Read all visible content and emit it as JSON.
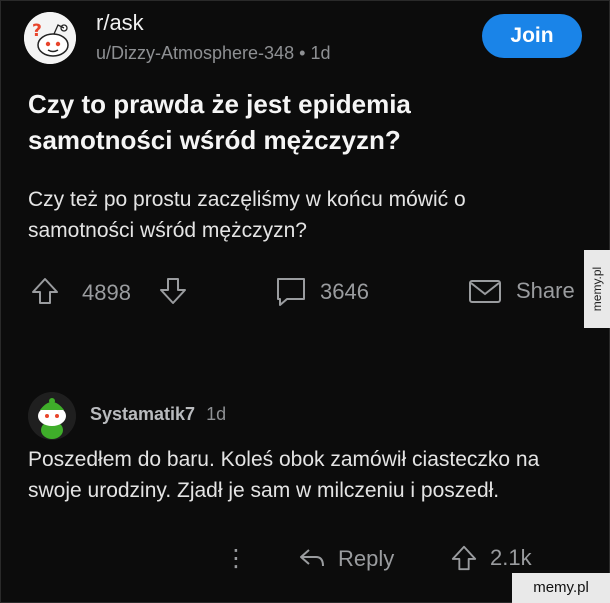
{
  "post": {
    "subreddit": "r/ask",
    "author": "u/Dizzy-Atmosphere-348",
    "separator": "•",
    "age": "1d",
    "join_label": "Join",
    "title": "Czy to prawda że jest epidemia samotności wśród mężczyzn?",
    "body": "Czy też po prostu zaczęliśmy w końcu mówić o samotności wśród mężczyzn?",
    "upvotes": "4898",
    "comments": "3646",
    "share_label": "Share"
  },
  "comment": {
    "username": "Systamatik7",
    "age": "1d",
    "text": "Poszedłem do baru. Koleś obok zamówił ciasteczko na swoje urodziny. Zjadł je sam w milczeniu i poszedł.",
    "more_label": "⋮",
    "reply_label": "Reply",
    "upvotes": "2.1k"
  },
  "watermarks": {
    "side": "memy.pl",
    "bottom": "memy.pl"
  },
  "colors": {
    "background": "#0c0c0c",
    "join_button": "#1a84e8",
    "muted_text": "#8e9093",
    "icon_gray": "#9a9c9f"
  }
}
